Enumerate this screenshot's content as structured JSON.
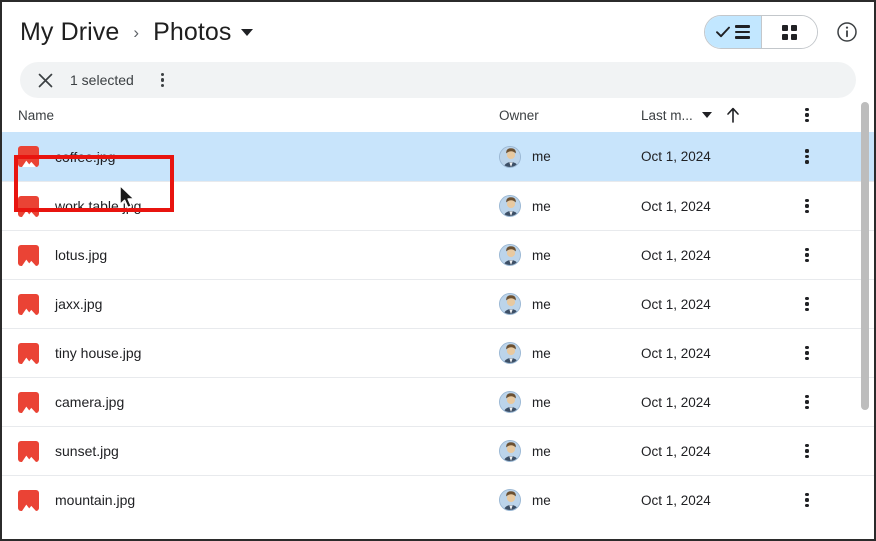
{
  "header": {
    "breadcrumb": {
      "root_label": "My Drive",
      "separator": "›",
      "current_label": "Photos",
      "current_icon": "chevron-down-icon"
    },
    "view_toggle": {
      "list_icon": "list-view-icon",
      "list_check_icon": "check-icon",
      "grid_icon": "grid-view-icon",
      "active": "list"
    },
    "info_icon": "info-circle-icon"
  },
  "selection_bar": {
    "close_icon": "close-icon",
    "count_label": "1 selected",
    "more_icon": "more-vertical-icon"
  },
  "table": {
    "columns": {
      "name": "Name",
      "owner": "Owner",
      "last_modified": "Last m...",
      "sort_caret_icon": "chevron-down-icon",
      "sort_direction_icon": "arrow-up-icon",
      "menu_icon": "more-vertical-icon"
    },
    "rows": [
      {
        "name": "coffee.jpg",
        "owner": "me",
        "modified": "Oct 1, 2024",
        "icon": "image-file-icon",
        "selected": true
      },
      {
        "name": "work table.jpg",
        "owner": "me",
        "modified": "Oct 1, 2024",
        "icon": "image-file-icon",
        "selected": false
      },
      {
        "name": "lotus.jpg",
        "owner": "me",
        "modified": "Oct 1, 2024",
        "icon": "image-file-icon",
        "selected": false
      },
      {
        "name": "jaxx.jpg",
        "owner": "me",
        "modified": "Oct 1, 2024",
        "icon": "image-file-icon",
        "selected": false
      },
      {
        "name": "tiny house.jpg",
        "owner": "me",
        "modified": "Oct 1, 2024",
        "icon": "image-file-icon",
        "selected": false
      },
      {
        "name": "camera.jpg",
        "owner": "me",
        "modified": "Oct 1, 2024",
        "icon": "image-file-icon",
        "selected": false
      },
      {
        "name": "sunset.jpg",
        "owner": "me",
        "modified": "Oct 1, 2024",
        "icon": "image-file-icon",
        "selected": false
      },
      {
        "name": "mountain.jpg",
        "owner": "me",
        "modified": "Oct 1, 2024",
        "icon": "image-file-icon",
        "selected": false
      }
    ],
    "row_action_icon": "more-vertical-icon"
  },
  "scrollbar": {
    "orientation": "vertical"
  },
  "annotation": {
    "shape": "rectangle",
    "color": "#e8140f",
    "target": "coffee.jpg"
  },
  "cursor": {
    "icon": "arrow-cursor"
  },
  "colors": {
    "selected_row": "#c8e4fb",
    "toggle_active": "#c2e7ff",
    "file_icon": "#ea4335",
    "annotation": "#e8140f",
    "selection_bar": "#f1f3f4"
  }
}
